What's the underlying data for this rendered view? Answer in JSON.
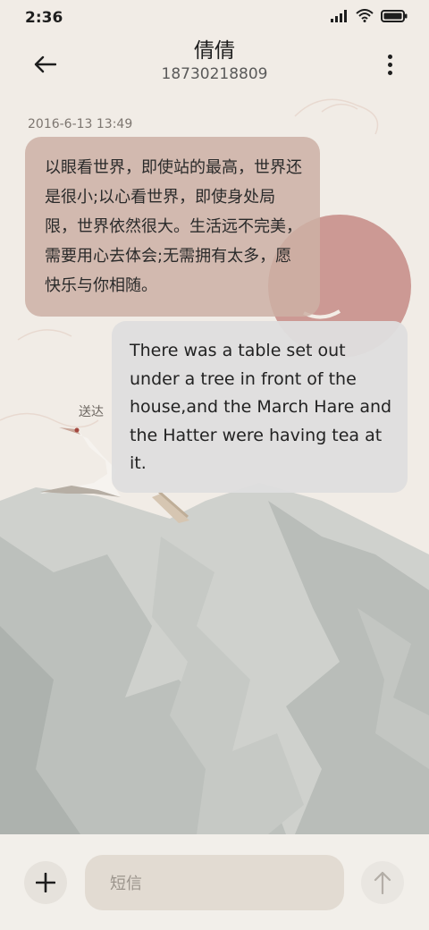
{
  "status_bar": {
    "time": "2:36",
    "icons": [
      "signal-icon",
      "wifi-icon",
      "battery-icon"
    ]
  },
  "header": {
    "contact_name": "倩倩",
    "contact_number": "18730218809",
    "back_icon": "back-arrow-icon",
    "more_icon": "more-vert-icon"
  },
  "conversation": {
    "timestamp": "2016-6-13 13:49",
    "messages": [
      {
        "direction": "incoming",
        "text": "以眼看世界，即使站的最高，世界还是很小;以心看世界，即使身处局限，世界依然很大。生活远不完美，需要用心去体会;无需拥有太多，愿快乐与你相随。"
      },
      {
        "direction": "outgoing",
        "text": "There was a table set out under a tree in front of the house,and the March Hare and the Hatter were having tea at it.",
        "status": "送达"
      }
    ]
  },
  "composer": {
    "add_icon": "plus-icon",
    "placeholder": "短信",
    "send_icon": "send-arrow-icon"
  },
  "colors": {
    "background": "#f1ece6",
    "incoming_bubble": "#ccb0a4",
    "outgoing_bubble": "#dedede",
    "sun": "#c9958f",
    "mountain": "#b7bcb8"
  }
}
